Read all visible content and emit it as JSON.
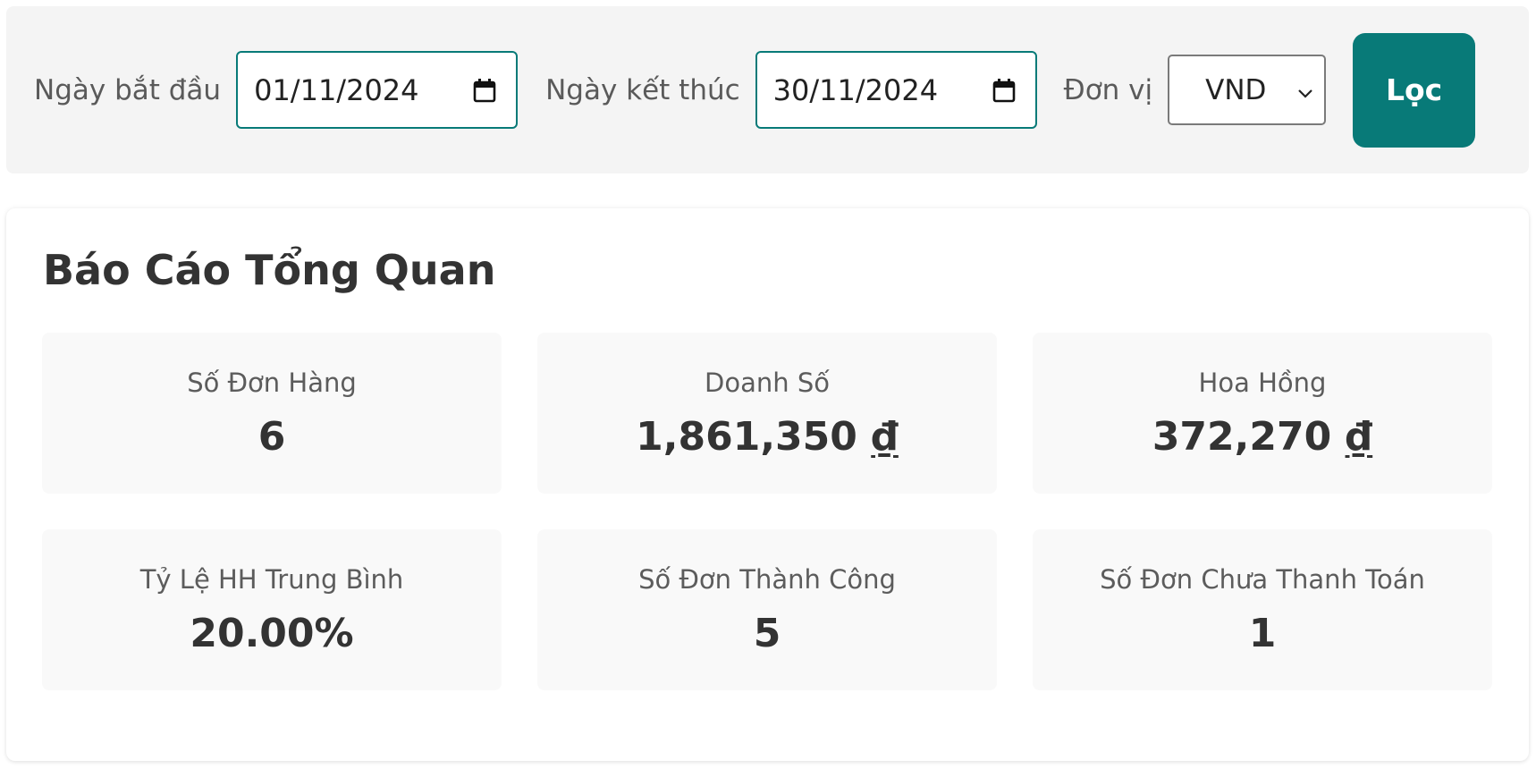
{
  "filter": {
    "start_label": "Ngày bắt đầu",
    "start_value": "01/11/2024",
    "end_label": "Ngày kết thúc",
    "end_value": "30/11/2024",
    "unit_label": "Đơn vị",
    "unit_value": "VND",
    "button_label": "Lọc"
  },
  "report": {
    "title": "Báo Cáo Tổng Quan",
    "stats": [
      {
        "label": "Số Đơn Hàng",
        "value": "6",
        "suffix": ""
      },
      {
        "label": "Doanh Số",
        "value": "1,861,350",
        "suffix": "₫"
      },
      {
        "label": "Hoa Hồng",
        "value": "372,270",
        "suffix": "₫"
      },
      {
        "label": "Tỷ Lệ HH Trung Bình",
        "value": "20.00%",
        "suffix": ""
      },
      {
        "label": "Số Đơn Thành Công",
        "value": "5",
        "suffix": ""
      },
      {
        "label": "Số Đơn Chưa Thanh Toán",
        "value": "1",
        "suffix": ""
      }
    ]
  },
  "colors": {
    "accent": "#087a78",
    "filter_bg": "#f4f4f4",
    "stat_card_bg": "#f9f9f9"
  },
  "icons": {
    "date_picker": "calendar-icon",
    "select": "chevron-down-icon"
  }
}
